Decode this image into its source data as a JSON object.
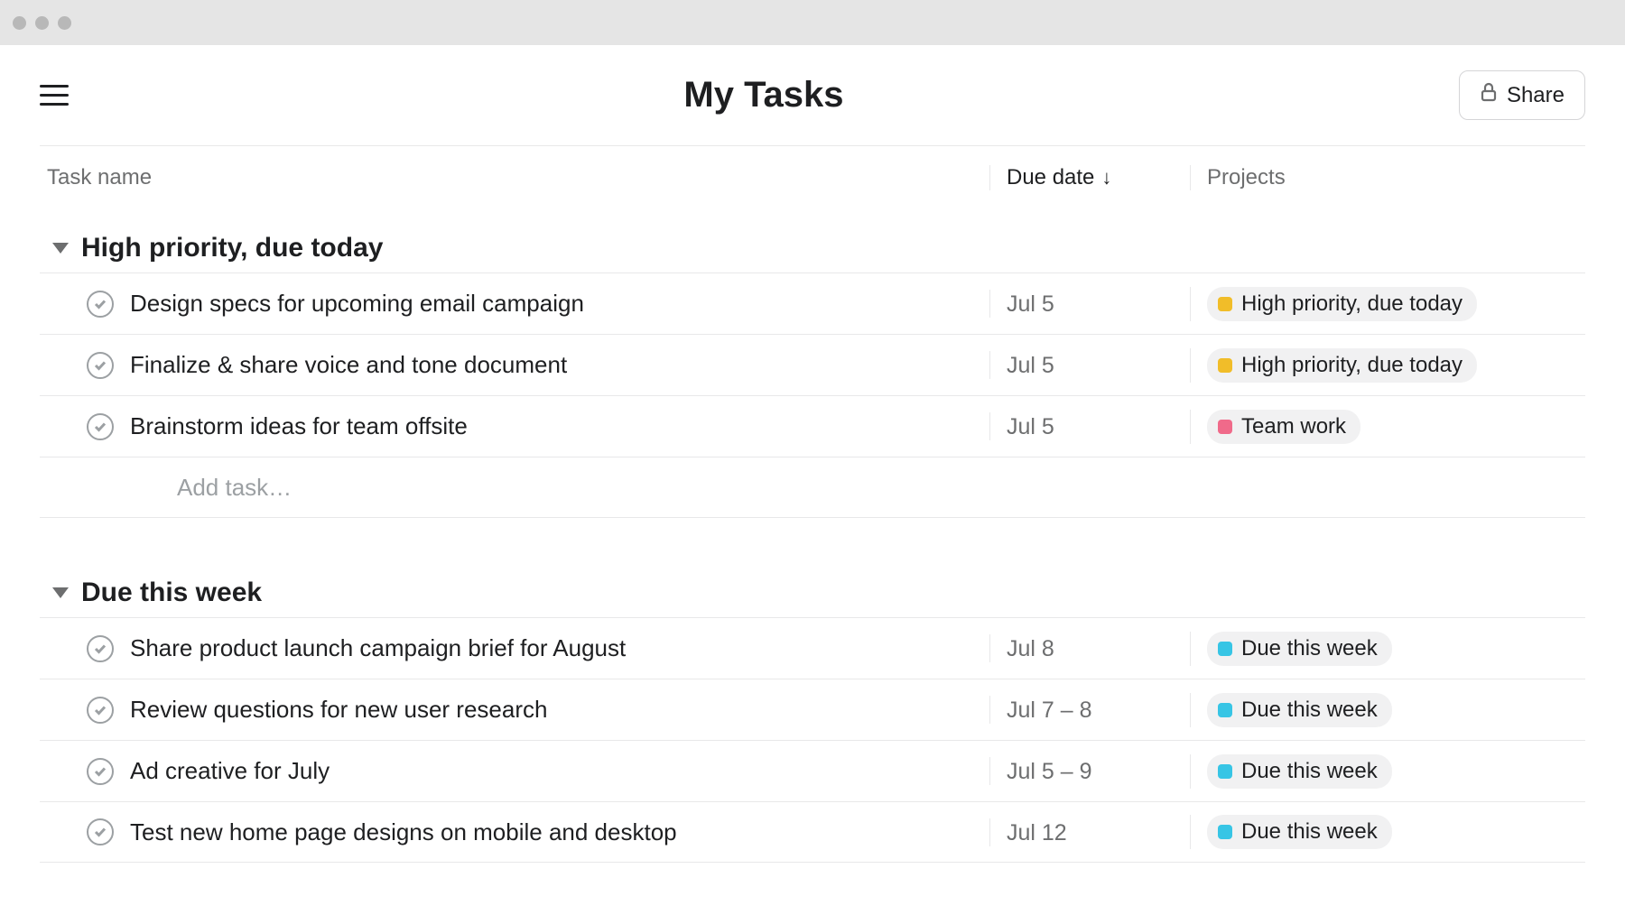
{
  "header": {
    "title": "My Tasks",
    "share_label": "Share"
  },
  "columns": {
    "name": "Task name",
    "due": "Due date",
    "projects": "Projects",
    "sort_indicator": "↓"
  },
  "add_task_placeholder": "Add task…",
  "project_tags": {
    "high_priority": {
      "label": "High priority, due today",
      "color": "#f1bd29"
    },
    "team_work": {
      "label": "Team work",
      "color": "#f06a8a"
    },
    "due_this_week": {
      "label": "Due this week",
      "color": "#37c5e5"
    }
  },
  "sections": [
    {
      "title": "High priority, due today",
      "show_add_task": true,
      "tasks": [
        {
          "name": "Design specs for upcoming email campaign",
          "due": "Jul 5",
          "tag": "high_priority"
        },
        {
          "name": "Finalize & share voice and tone document",
          "due": "Jul 5",
          "tag": "high_priority"
        },
        {
          "name": "Brainstorm ideas for team offsite",
          "due": "Jul 5",
          "tag": "team_work"
        }
      ]
    },
    {
      "title": "Due this week",
      "show_add_task": false,
      "tasks": [
        {
          "name": "Share product launch campaign brief for August",
          "due": "Jul 8",
          "tag": "due_this_week"
        },
        {
          "name": "Review questions for new user research",
          "due": "Jul 7 – 8",
          "tag": "due_this_week"
        },
        {
          "name": "Ad creative for July",
          "due": "Jul 5 – 9",
          "tag": "due_this_week"
        },
        {
          "name": "Test new home page designs on mobile and desktop",
          "due": "Jul 12",
          "tag": "due_this_week"
        }
      ]
    }
  ]
}
